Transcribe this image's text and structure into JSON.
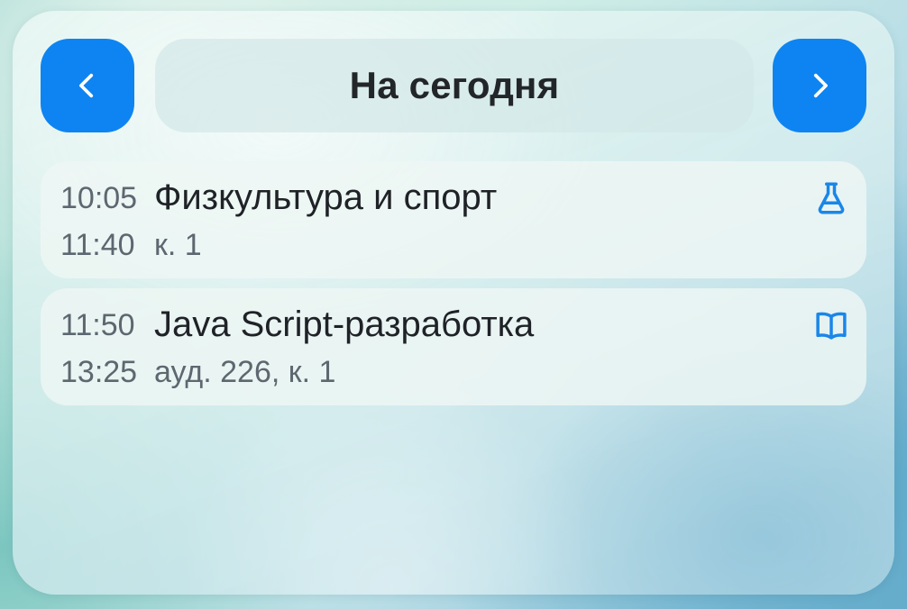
{
  "header": {
    "title": "На сегодня",
    "prev_icon": "chevron-left-icon",
    "next_icon": "chevron-right-icon",
    "accent_color": "#0d84f2"
  },
  "lessons": [
    {
      "start": "10:05",
      "end": "11:40",
      "title": "Физкультура и спорт",
      "room": "к. 1",
      "icon": "flask-icon"
    },
    {
      "start": "11:50",
      "end": "13:25",
      "title": "Java Script-разработка",
      "room": "ауд. 226, к. 1",
      "icon": "book-icon"
    }
  ]
}
